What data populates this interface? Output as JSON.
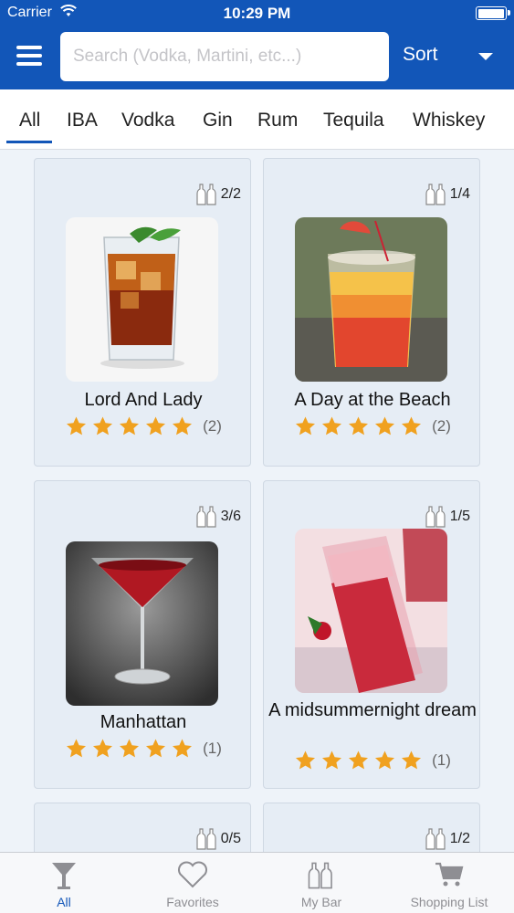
{
  "status_bar": {
    "carrier": "Carrier",
    "time": "10:29 PM"
  },
  "search": {
    "placeholder": "Search (Vodka, Martini, etc...)",
    "value": ""
  },
  "sort_label": "Sort",
  "tabs": [
    "All",
    "IBA",
    "Vodka",
    "Gin",
    "Rum",
    "Tequila",
    "Whiskey"
  ],
  "active_tab": "All",
  "cocktails": [
    {
      "name": "Lord And Lady",
      "ingredients": "2/2",
      "stars": 5,
      "rating_count": "(2)"
    },
    {
      "name": "A Day at the Beach",
      "ingredients": "1/4",
      "stars": 5,
      "rating_count": "(2)"
    },
    {
      "name": "Manhattan",
      "ingredients": "3/6",
      "stars": 5,
      "rating_count": "(1)"
    },
    {
      "name": "A midsummernight dream",
      "ingredients": "1/5",
      "stars": 5,
      "rating_count": "(1)"
    },
    {
      "name": "",
      "ingredients": "0/5"
    },
    {
      "name": "",
      "ingredients": "1/2"
    }
  ],
  "bottom_nav": [
    {
      "label": "All",
      "icon": "cocktail-glass-icon"
    },
    {
      "label": "Favorites",
      "icon": "heart-icon"
    },
    {
      "label": "My Bar",
      "icon": "bottles-icon"
    },
    {
      "label": "Shopping List",
      "icon": "cart-icon"
    }
  ],
  "colors": {
    "primary": "#1256b8",
    "star": "#f0a11f",
    "card": "#e6edf5",
    "background": "#eef3f9"
  }
}
